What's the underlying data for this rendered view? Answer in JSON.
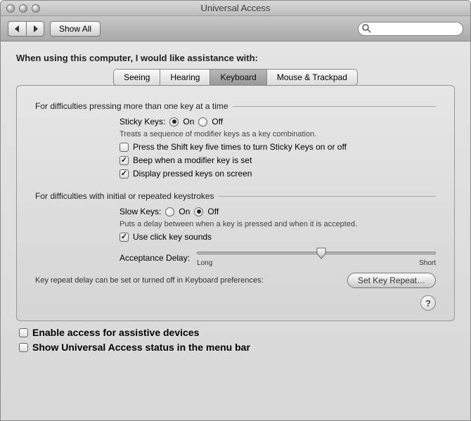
{
  "window": {
    "title": "Universal Access"
  },
  "toolbar": {
    "show_all": "Show All",
    "search_placeholder": ""
  },
  "prompt": "When using this computer, I would like assistance with:",
  "tabs": {
    "seeing": "Seeing",
    "hearing": "Hearing",
    "keyboard": "Keyboard",
    "mouse": "Mouse & Trackpad",
    "active": "keyboard"
  },
  "sticky": {
    "section": "For difficulties pressing more than one key at a time",
    "label": "Sticky Keys:",
    "on": "On",
    "off": "Off",
    "value": "on",
    "hint": "Treats a sequence of modifier keys as a key combination.",
    "opt_shift5": "Press the Shift key five times to turn Sticky Keys on or off",
    "opt_beep": "Beep when a modifier key is set",
    "opt_display": "Display pressed keys on screen",
    "shift5_checked": false,
    "beep_checked": true,
    "display_checked": true
  },
  "slow": {
    "section": "For difficulties with initial or repeated keystrokes",
    "label": "Slow Keys:",
    "on": "On",
    "off": "Off",
    "value": "off",
    "hint": "Puts a delay between when a key is pressed and when it is accepted.",
    "opt_click": "Use click key sounds",
    "click_checked": true,
    "delay_label": "Acceptance Delay:",
    "delay_long": "Long",
    "delay_short": "Short",
    "delay_value": 0.52
  },
  "repeat": {
    "hint": "Key repeat delay can be set or turned off in Keyboard preferences:",
    "button": "Set Key Repeat…"
  },
  "help_tooltip": "?",
  "bottom": {
    "assistive": "Enable access for assistive devices",
    "menubar": "Show Universal Access status in the menu bar",
    "assistive_checked": false,
    "menubar_checked": false
  }
}
